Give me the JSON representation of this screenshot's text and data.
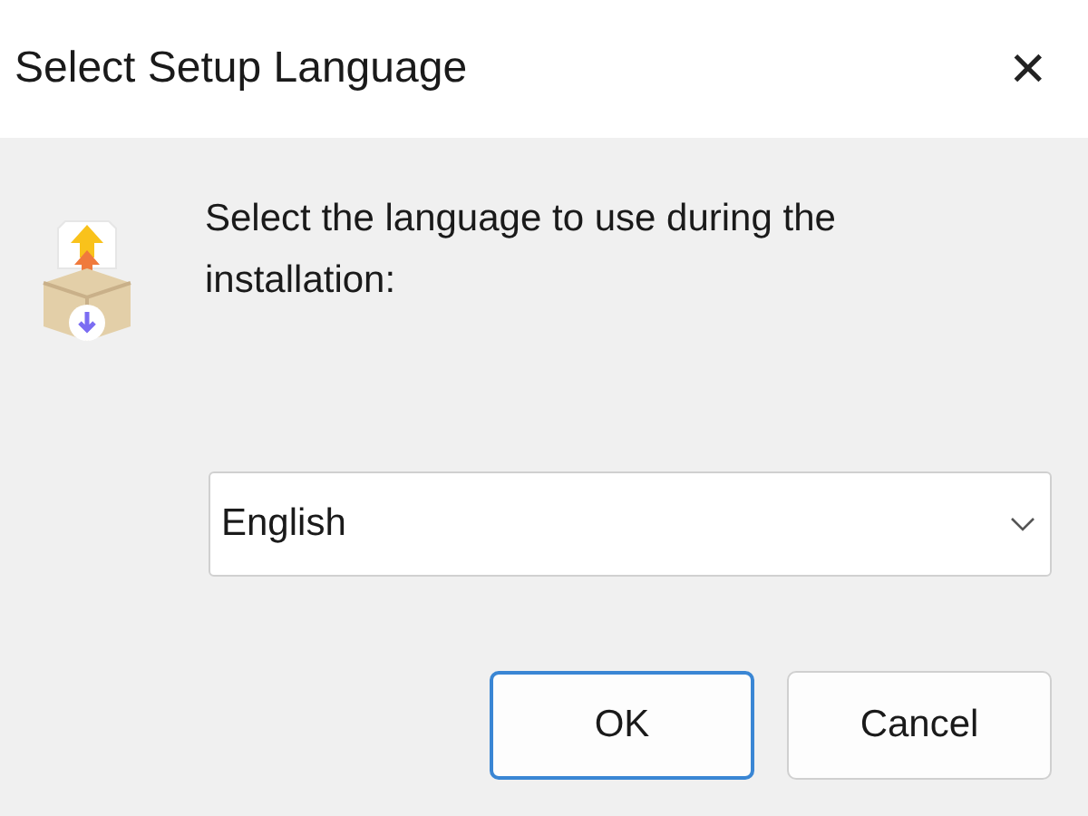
{
  "window": {
    "title": "Select Setup Language",
    "close": "✕"
  },
  "message": "Select the language to use during the installation:",
  "language_dropdown": {
    "value": "English"
  },
  "buttons": [
    {
      "label": "OK",
      "default": true
    },
    {
      "label": "Cancel",
      "default": false
    }
  ]
}
